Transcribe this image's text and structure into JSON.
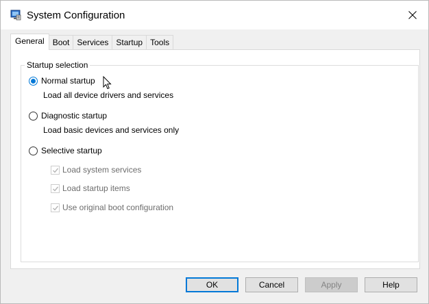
{
  "window": {
    "title": "System Configuration",
    "app_icon": "msconfig-icon",
    "close_icon": "close-icon"
  },
  "tabs": [
    {
      "label": "General",
      "active": true
    },
    {
      "label": "Boot",
      "active": false
    },
    {
      "label": "Services",
      "active": false
    },
    {
      "label": "Startup",
      "active": false
    },
    {
      "label": "Tools",
      "active": false
    }
  ],
  "general": {
    "group_title": "Startup selection",
    "options": [
      {
        "label": "Normal startup",
        "description": "Load all device drivers and services",
        "selected": true
      },
      {
        "label": "Diagnostic startup",
        "description": "Load basic devices and services only",
        "selected": false
      },
      {
        "label": "Selective startup",
        "description": "",
        "selected": false
      }
    ],
    "selective_items": [
      {
        "label": "Load system services",
        "checked": true,
        "enabled": false
      },
      {
        "label": "Load startup items",
        "checked": true,
        "enabled": false
      },
      {
        "label": "Use original boot configuration",
        "checked": true,
        "enabled": false
      }
    ]
  },
  "buttons": {
    "ok": "OK",
    "cancel": "Cancel",
    "apply": "Apply",
    "help": "Help"
  },
  "colors": {
    "accent": "#0078d7",
    "disabled_text": "#6d6d6d"
  }
}
